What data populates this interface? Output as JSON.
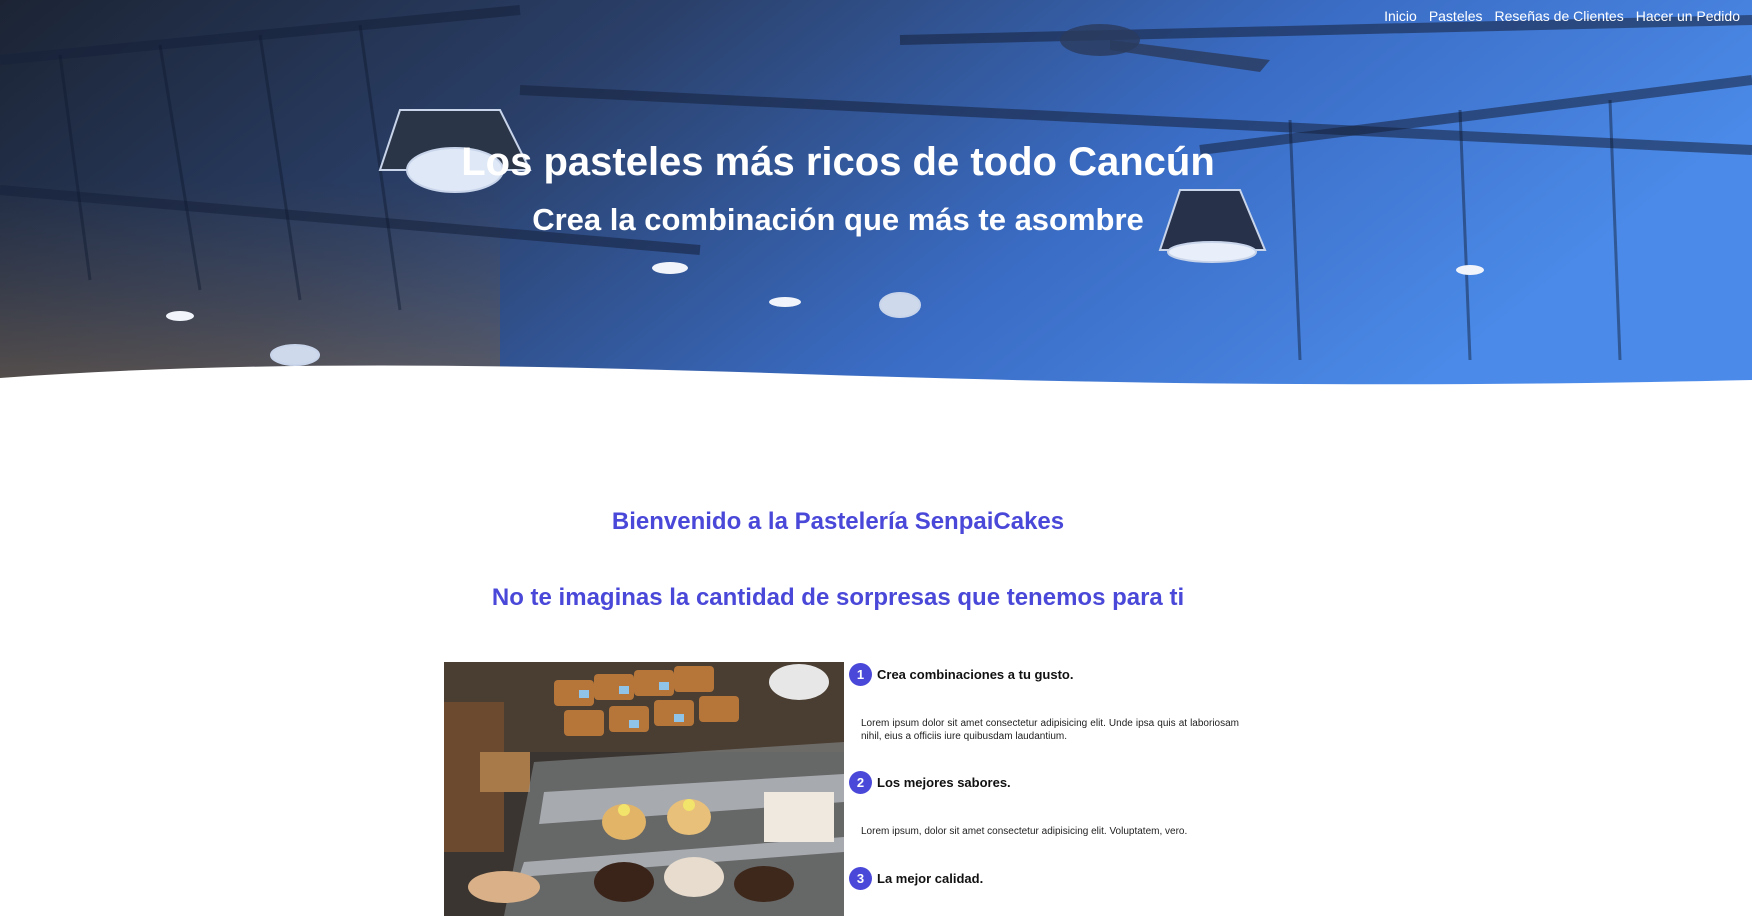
{
  "nav": {
    "items": [
      {
        "label": "Inicio"
      },
      {
        "label": "Pasteles"
      },
      {
        "label": "Reseñas de Clientes"
      },
      {
        "label": "Hacer un Pedido"
      }
    ]
  },
  "hero": {
    "title": "Los pasteles más ricos de todo Cancún",
    "subtitle": "Crea la combinación que más te asombre"
  },
  "main": {
    "welcome": "Bienvenido a la Pastelería SenpaiCakes",
    "surprise": "No te imaginas la cantidad de sorpresas que tenemos para ti",
    "features": [
      {
        "number": "1",
        "title": "Crea combinaciones a tu gusto.",
        "text": "Lorem ipsum dolor sit amet consectetur adipisicing elit. Unde ipsa quis at laboriosam nihil, eius a officiis iure quibusdam laudantium."
      },
      {
        "number": "2",
        "title": "Los mejores sabores.",
        "text": "Lorem ipsum, dolor sit amet consectetur adipisicing elit. Voluptatem, vero."
      },
      {
        "number": "3",
        "title": "La mejor calidad.",
        "text": ""
      }
    ]
  },
  "colors": {
    "accent": "#4a48d8",
    "hero_overlay": "#3b7de0"
  }
}
